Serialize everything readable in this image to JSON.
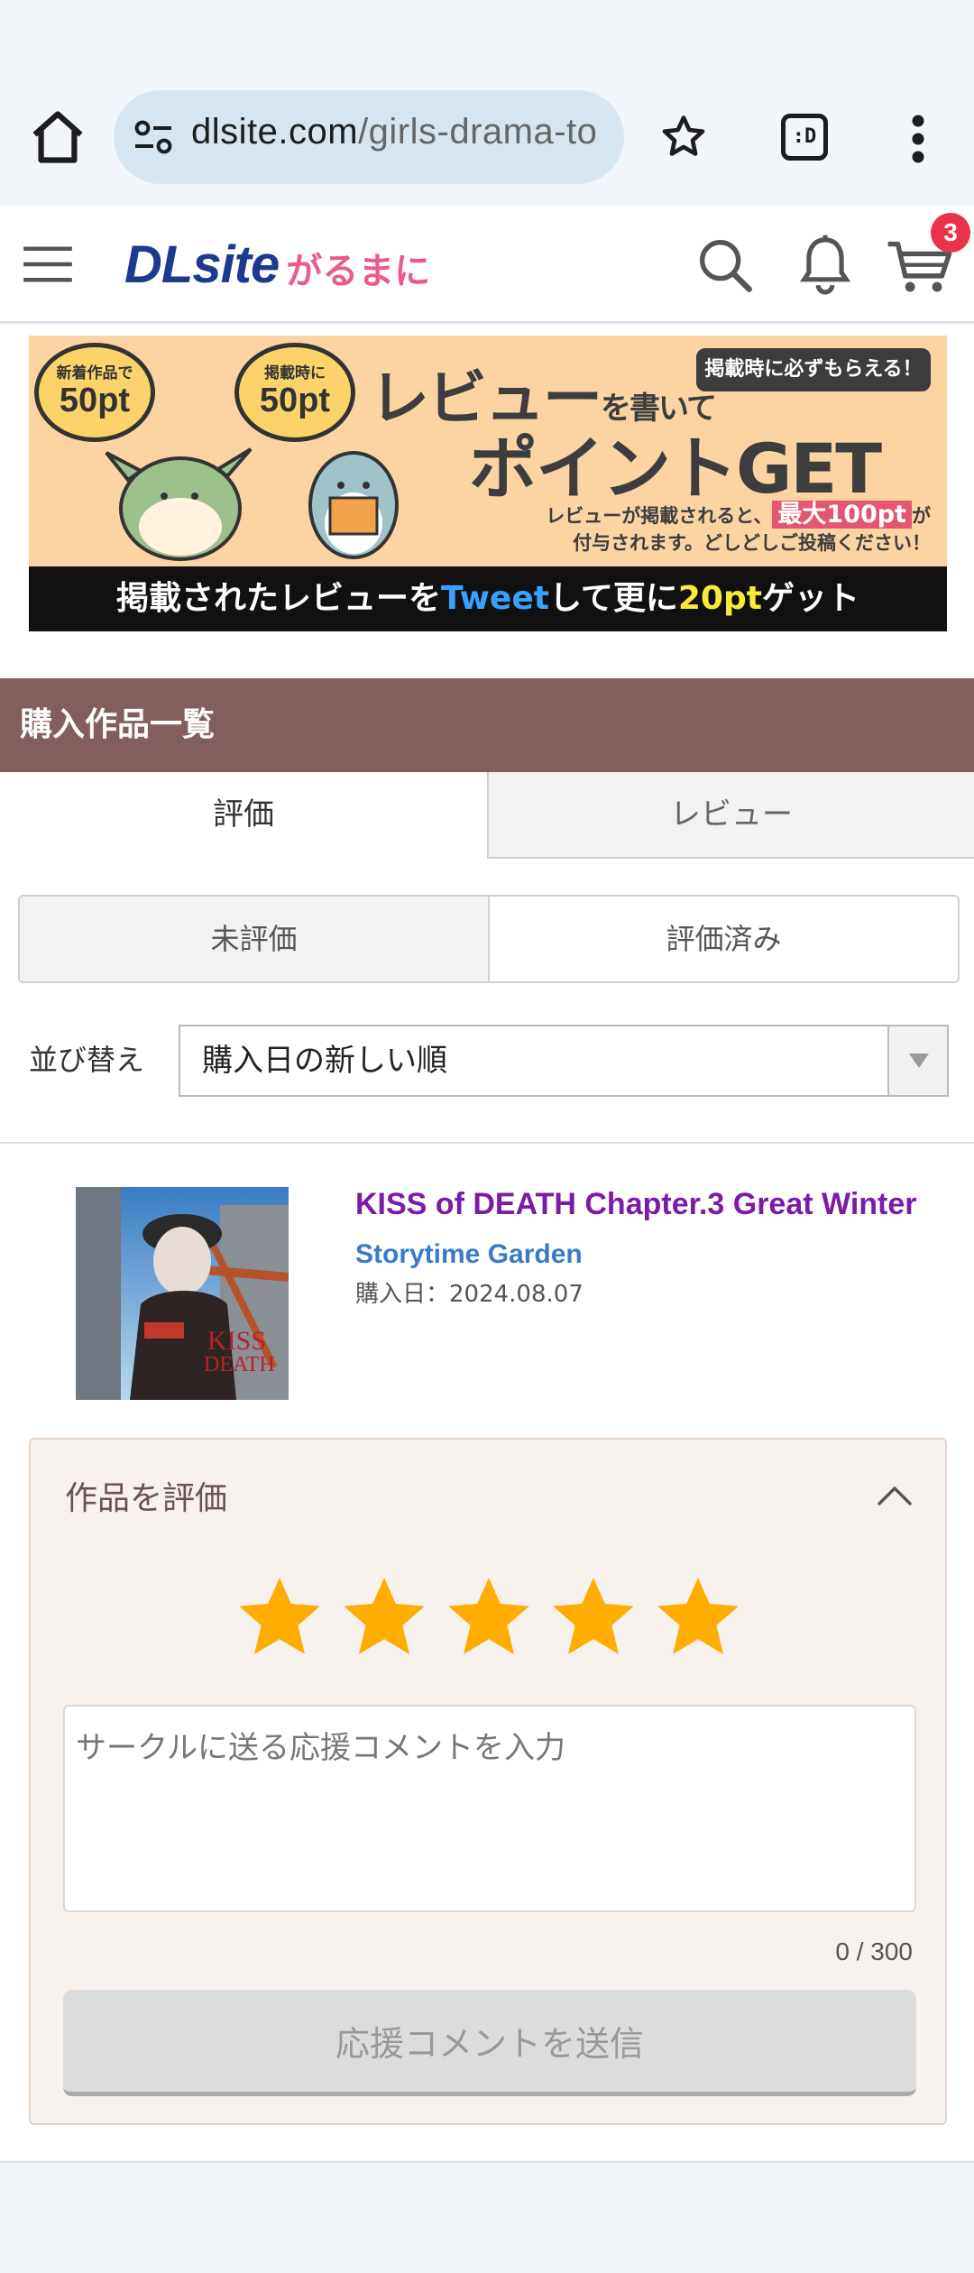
{
  "browser": {
    "url_host": "dlsite.com",
    "url_path": "/girls-drama-to",
    "tab_switcher_label": ":D"
  },
  "header": {
    "logo_main": "DLsite",
    "logo_sub": "がるまに",
    "cart_count": "3"
  },
  "banner": {
    "bubble1_small": "新着作品で",
    "bubble1_big": "50pt",
    "bubble2_small": "掲載時に",
    "bubble2_big": "50pt",
    "pill": "掲載時に必ずもらえる！",
    "headline_a": "レビュー",
    "headline_b": "を書いて",
    "headline2": "ポイントGET",
    "fine_a": "レビューが掲載されると、",
    "fine_highlight": "最大100pt",
    "fine_b": "が",
    "fine_c": "付与されます。どしどしご投稿ください！",
    "bottom_a": "掲載されたレビューを",
    "bottom_tweet": "Tweet",
    "bottom_b": "して更に",
    "bottom_pt": "20pt",
    "bottom_c": "ゲット"
  },
  "section": {
    "title": "購入作品一覧"
  },
  "tabs": {
    "rating": "評価",
    "review": "レビュー"
  },
  "subtabs": {
    "unrated": "未評価",
    "rated": "評価済み"
  },
  "sort": {
    "label": "並び替え",
    "selected": "購入日の新しい順"
  },
  "work": {
    "title": "KISS of DEATH Chapter.3 Great Winter",
    "circle": "Storytime Garden",
    "purchase_date": "購入日：2024.08.07"
  },
  "rating_panel": {
    "heading": "作品を評価",
    "stars": 5,
    "comment_placeholder": "サークルに送る応援コメントを入力",
    "counter": "0 / 300",
    "send_label": "応援コメントを送信"
  },
  "colors": {
    "section_bg": "#845e5e",
    "title": "#7b1ba6",
    "circle": "#3a7bc8",
    "star": "#ffad00"
  }
}
